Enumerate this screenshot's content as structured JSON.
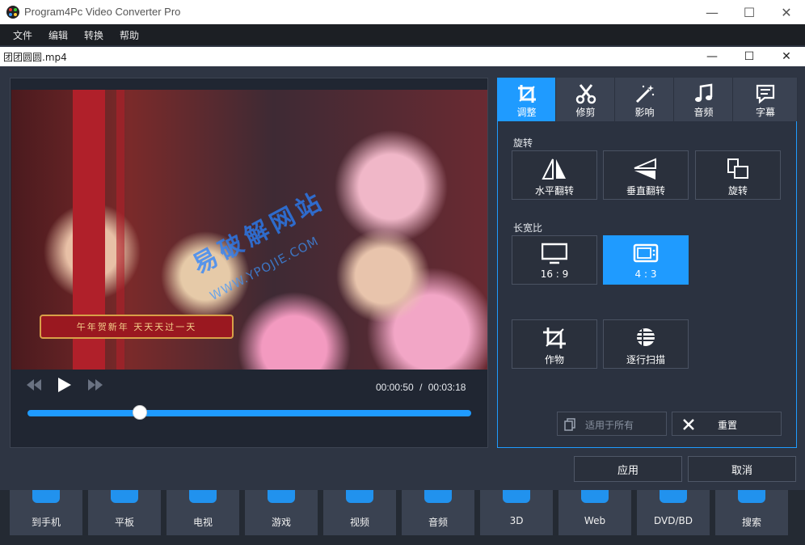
{
  "app": {
    "title": "Program4Pc Video Converter Pro",
    "window_controls": {
      "minimize": "—",
      "maximize": "☐",
      "close": "✕"
    }
  },
  "menu": [
    "文件",
    "编辑",
    "转换",
    "帮助"
  ],
  "devices": [
    "到手机",
    "平板",
    "电视",
    "游戏",
    "视频",
    "音频",
    "3D",
    "Web",
    "DVD/BD",
    "搜索"
  ],
  "dialog": {
    "title": "团团圆圆.mp4",
    "player": {
      "current_time": "00:00:50",
      "separator": "/",
      "total_time": "00:03:18",
      "progress": 0.25,
      "overlay_banner": "午年贺新年  天天天过一天",
      "watermark_cn": "易破解网站",
      "watermark_url": "WWW.YPOJIE.COM"
    },
    "tabs": [
      {
        "label": "调整",
        "icon": "crop-icon",
        "active": true
      },
      {
        "label": "修剪",
        "icon": "scissors-icon",
        "active": false
      },
      {
        "label": "影响",
        "icon": "magic-wand-icon",
        "active": false
      },
      {
        "label": "音频",
        "icon": "music-note-icon",
        "active": false
      },
      {
        "label": "字幕",
        "icon": "subtitle-icon",
        "active": false
      }
    ],
    "rotate_section": {
      "title": "旋转",
      "options": [
        "水平翻转",
        "垂直翻转",
        "旋转"
      ]
    },
    "aspect_section": {
      "title": "长宽比",
      "options": [
        "16 : 9",
        "4 : 3"
      ],
      "selected": "4 : 3"
    },
    "other_options": [
      "作物",
      "逐行扫描"
    ],
    "apply_all": "适用于所有",
    "reset": "重置",
    "apply": "应用",
    "cancel": "取消"
  },
  "colors": {
    "accent": "#1f9bff",
    "background": "#2e3543",
    "panel": "#2b3240"
  }
}
